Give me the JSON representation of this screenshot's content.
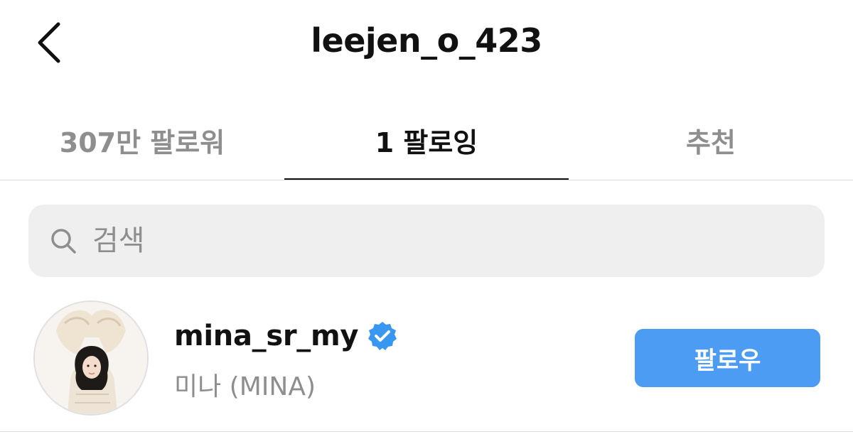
{
  "header": {
    "title": "leejen_o_423",
    "back_icon": "chevron-left-icon"
  },
  "tabs": [
    {
      "label": "307만 팔로워",
      "active": false
    },
    {
      "label": "1 팔로잉",
      "active": true
    },
    {
      "label": "추천",
      "active": false
    }
  ],
  "search": {
    "placeholder": "검색",
    "value": "",
    "icon": "search-icon"
  },
  "users": [
    {
      "username": "mina_sr_my",
      "full_name": "미나 (MINA)",
      "verified": true,
      "action_label": "팔로우"
    }
  ],
  "colors": {
    "accent": "#4d9cf4",
    "verified": "#3897f0",
    "muted_text": "#8e8e8e",
    "search_bg": "#efefef",
    "divider": "#dbdbdb"
  }
}
